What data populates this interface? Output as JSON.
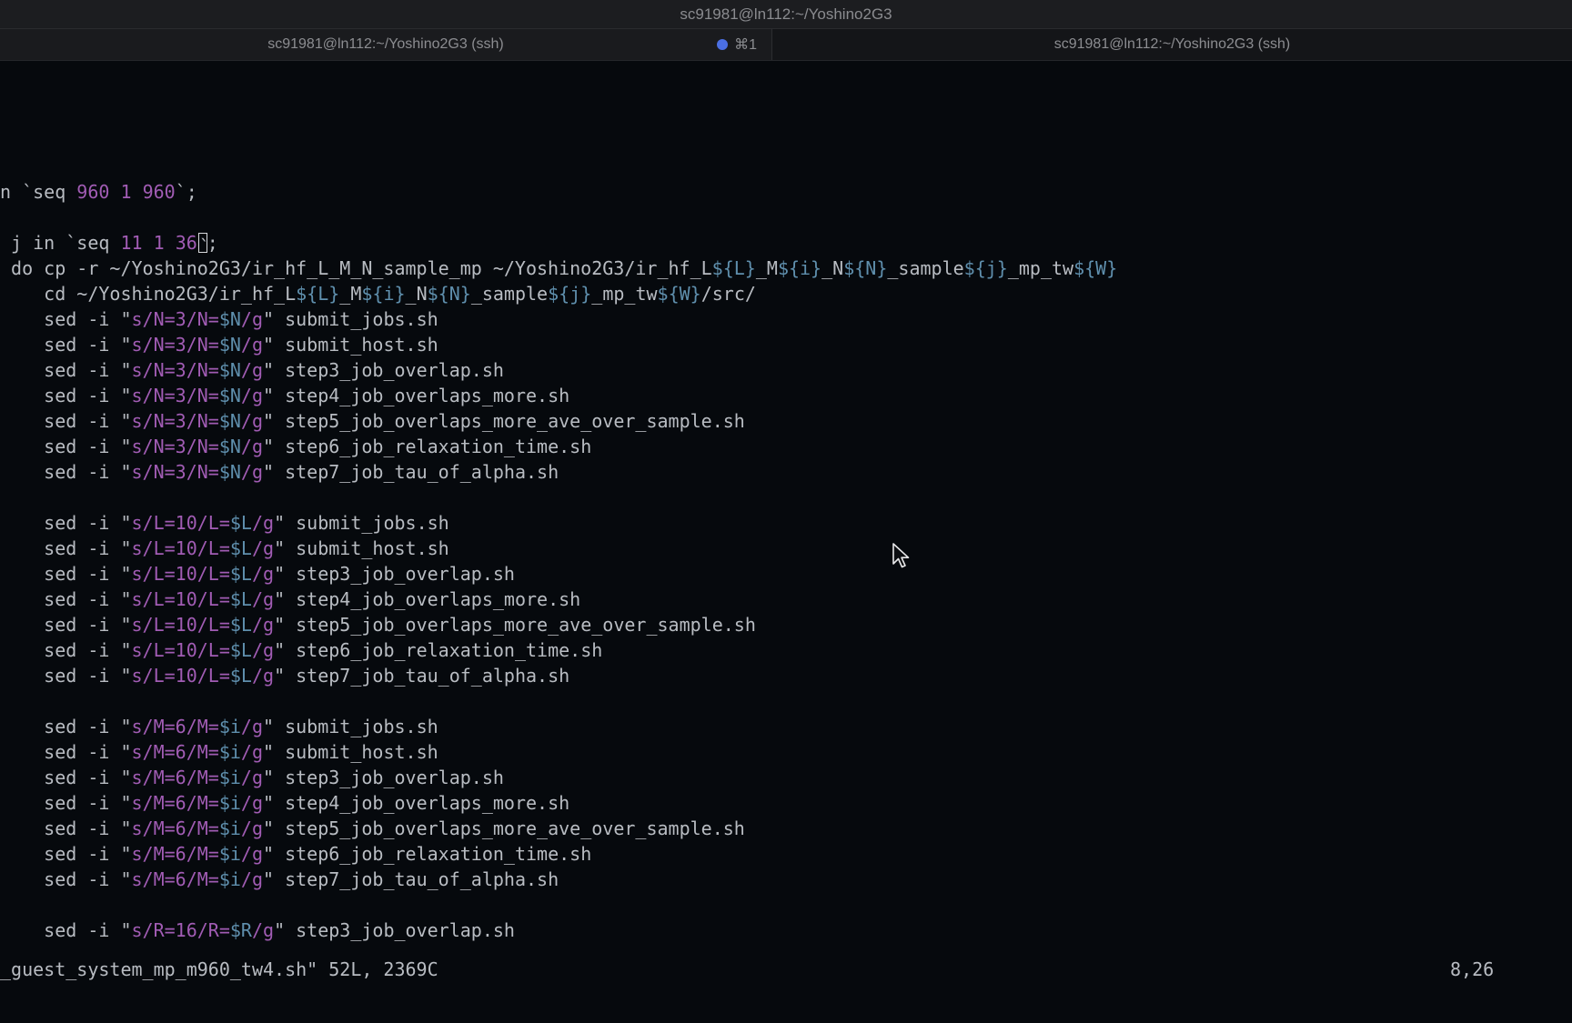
{
  "window": {
    "title": "sc91981@ln112:~/Yoshino2G3"
  },
  "tabs": [
    {
      "label": "sc91981@ln112:~/Yoshino2G3 (ssh)",
      "shortcut": "⌘1",
      "active": true,
      "activity_color": "#4b6fe3"
    },
    {
      "label": "sc91981@ln112:~/Yoshino2G3 (ssh)",
      "active": false
    }
  ],
  "terminal": {
    "lines": [
      {
        "row": 5,
        "segments": [
          {
            "t": "n `seq "
          },
          {
            "t": "960",
            "c": "p"
          },
          {
            "t": " "
          },
          {
            "t": "1",
            "c": "p"
          },
          {
            "t": " "
          },
          {
            "t": "960",
            "c": "p"
          },
          {
            "t": "`;"
          }
        ]
      },
      {
        "row": 7,
        "segments": [
          {
            "t": " j in `seq "
          },
          {
            "t": "11",
            "c": "p"
          },
          {
            "t": " "
          },
          {
            "t": "1",
            "c": "p"
          },
          {
            "t": " "
          },
          {
            "t": "36",
            "c": "p"
          },
          {
            "t": "`",
            "cursor": true
          },
          {
            "t": ";"
          }
        ]
      },
      {
        "row": 8,
        "segments": [
          {
            "t": " do cp -r ~/Yoshino2G3/ir_hf_L_M_N_sample_mp ~/Yoshino2G3/ir_hf_L"
          },
          {
            "t": "${L}",
            "c": "v"
          },
          {
            "t": "_M"
          },
          {
            "t": "${i}",
            "c": "v"
          },
          {
            "t": "_N"
          },
          {
            "t": "${N}",
            "c": "v"
          },
          {
            "t": "_sample"
          },
          {
            "t": "${j}",
            "c": "v"
          },
          {
            "t": "_mp_tw"
          },
          {
            "t": "${W}",
            "c": "v"
          }
        ]
      },
      {
        "row": 9,
        "segments": [
          {
            "t": "    cd ~/Yoshino2G3/ir_hf_L"
          },
          {
            "t": "${L}",
            "c": "v"
          },
          {
            "t": "_M"
          },
          {
            "t": "${i}",
            "c": "v"
          },
          {
            "t": "_N"
          },
          {
            "t": "${N}",
            "c": "v"
          },
          {
            "t": "_sample"
          },
          {
            "t": "${j}",
            "c": "v"
          },
          {
            "t": "_mp_tw"
          },
          {
            "t": "${W}",
            "c": "v"
          },
          {
            "t": "/src/"
          }
        ]
      },
      {
        "row": 10,
        "segments": [
          {
            "t": "    sed -i \""
          },
          {
            "t": "s/N=3/N=",
            "c": "p"
          },
          {
            "t": "$N",
            "c": "v"
          },
          {
            "t": "/g",
            "c": "p"
          },
          {
            "t": "\" submit_jobs.sh"
          }
        ]
      },
      {
        "row": 11,
        "segments": [
          {
            "t": "    sed -i \""
          },
          {
            "t": "s/N=3/N=",
            "c": "p"
          },
          {
            "t": "$N",
            "c": "v"
          },
          {
            "t": "/g",
            "c": "p"
          },
          {
            "t": "\" submit_host.sh"
          }
        ]
      },
      {
        "row": 12,
        "segments": [
          {
            "t": "    sed -i \""
          },
          {
            "t": "s/N=3/N=",
            "c": "p"
          },
          {
            "t": "$N",
            "c": "v"
          },
          {
            "t": "/g",
            "c": "p"
          },
          {
            "t": "\" step3_job_overlap.sh"
          }
        ]
      },
      {
        "row": 13,
        "segments": [
          {
            "t": "    sed -i \""
          },
          {
            "t": "s/N=3/N=",
            "c": "p"
          },
          {
            "t": "$N",
            "c": "v"
          },
          {
            "t": "/g",
            "c": "p"
          },
          {
            "t": "\" step4_job_overlaps_more.sh"
          }
        ]
      },
      {
        "row": 14,
        "segments": [
          {
            "t": "    sed -i \""
          },
          {
            "t": "s/N=3/N=",
            "c": "p"
          },
          {
            "t": "$N",
            "c": "v"
          },
          {
            "t": "/g",
            "c": "p"
          },
          {
            "t": "\" step5_job_overlaps_more_ave_over_sample.sh"
          }
        ]
      },
      {
        "row": 15,
        "segments": [
          {
            "t": "    sed -i \""
          },
          {
            "t": "s/N=3/N=",
            "c": "p"
          },
          {
            "t": "$N",
            "c": "v"
          },
          {
            "t": "/g",
            "c": "p"
          },
          {
            "t": "\" step6_job_relaxation_time.sh"
          }
        ]
      },
      {
        "row": 16,
        "segments": [
          {
            "t": "    sed -i \""
          },
          {
            "t": "s/N=3/N=",
            "c": "p"
          },
          {
            "t": "$N",
            "c": "v"
          },
          {
            "t": "/g",
            "c": "p"
          },
          {
            "t": "\" step7_job_tau_of_alpha.sh"
          }
        ]
      },
      {
        "row": 18,
        "segments": [
          {
            "t": "    sed -i \""
          },
          {
            "t": "s/L=10/L=",
            "c": "p"
          },
          {
            "t": "$L",
            "c": "v"
          },
          {
            "t": "/g",
            "c": "p"
          },
          {
            "t": "\" submit_jobs.sh"
          }
        ]
      },
      {
        "row": 19,
        "segments": [
          {
            "t": "    sed -i \""
          },
          {
            "t": "s/L=10/L=",
            "c": "p"
          },
          {
            "t": "$L",
            "c": "v"
          },
          {
            "t": "/g",
            "c": "p"
          },
          {
            "t": "\" submit_host.sh"
          }
        ]
      },
      {
        "row": 20,
        "segments": [
          {
            "t": "    sed -i \""
          },
          {
            "t": "s/L=10/L=",
            "c": "p"
          },
          {
            "t": "$L",
            "c": "v"
          },
          {
            "t": "/g",
            "c": "p"
          },
          {
            "t": "\" step3_job_overlap.sh"
          }
        ]
      },
      {
        "row": 21,
        "segments": [
          {
            "t": "    sed -i \""
          },
          {
            "t": "s/L=10/L=",
            "c": "p"
          },
          {
            "t": "$L",
            "c": "v"
          },
          {
            "t": "/g",
            "c": "p"
          },
          {
            "t": "\" step4_job_overlaps_more.sh"
          }
        ]
      },
      {
        "row": 22,
        "segments": [
          {
            "t": "    sed -i \""
          },
          {
            "t": "s/L=10/L=",
            "c": "p"
          },
          {
            "t": "$L",
            "c": "v"
          },
          {
            "t": "/g",
            "c": "p"
          },
          {
            "t": "\" step5_job_overlaps_more_ave_over_sample.sh"
          }
        ]
      },
      {
        "row": 23,
        "segments": [
          {
            "t": "    sed -i \""
          },
          {
            "t": "s/L=10/L=",
            "c": "p"
          },
          {
            "t": "$L",
            "c": "v"
          },
          {
            "t": "/g",
            "c": "p"
          },
          {
            "t": "\" step6_job_relaxation_time.sh"
          }
        ]
      },
      {
        "row": 24,
        "segments": [
          {
            "t": "    sed -i \""
          },
          {
            "t": "s/L=10/L=",
            "c": "p"
          },
          {
            "t": "$L",
            "c": "v"
          },
          {
            "t": "/g",
            "c": "p"
          },
          {
            "t": "\" step7_job_tau_of_alpha.sh"
          }
        ]
      },
      {
        "row": 26,
        "segments": [
          {
            "t": "    sed -i \""
          },
          {
            "t": "s/M=6/M=",
            "c": "p"
          },
          {
            "t": "$i",
            "c": "v"
          },
          {
            "t": "/g",
            "c": "p"
          },
          {
            "t": "\" submit_jobs.sh"
          }
        ]
      },
      {
        "row": 27,
        "segments": [
          {
            "t": "    sed -i \""
          },
          {
            "t": "s/M=6/M=",
            "c": "p"
          },
          {
            "t": "$i",
            "c": "v"
          },
          {
            "t": "/g",
            "c": "p"
          },
          {
            "t": "\" submit_host.sh"
          }
        ]
      },
      {
        "row": 28,
        "segments": [
          {
            "t": "    sed -i \""
          },
          {
            "t": "s/M=6/M=",
            "c": "p"
          },
          {
            "t": "$i",
            "c": "v"
          },
          {
            "t": "/g",
            "c": "p"
          },
          {
            "t": "\" step3_job_overlap.sh"
          }
        ]
      },
      {
        "row": 29,
        "segments": [
          {
            "t": "    sed -i \""
          },
          {
            "t": "s/M=6/M=",
            "c": "p"
          },
          {
            "t": "$i",
            "c": "v"
          },
          {
            "t": "/g",
            "c": "p"
          },
          {
            "t": "\" step4_job_overlaps_more.sh"
          }
        ]
      },
      {
        "row": 30,
        "segments": [
          {
            "t": "    sed -i \""
          },
          {
            "t": "s/M=6/M=",
            "c": "p"
          },
          {
            "t": "$i",
            "c": "v"
          },
          {
            "t": "/g",
            "c": "p"
          },
          {
            "t": "\" step5_job_overlaps_more_ave_over_sample.sh"
          }
        ]
      },
      {
        "row": 31,
        "segments": [
          {
            "t": "    sed -i \""
          },
          {
            "t": "s/M=6/M=",
            "c": "p"
          },
          {
            "t": "$i",
            "c": "v"
          },
          {
            "t": "/g",
            "c": "p"
          },
          {
            "t": "\" step6_job_relaxation_time.sh"
          }
        ]
      },
      {
        "row": 32,
        "segments": [
          {
            "t": "    sed -i \""
          },
          {
            "t": "s/M=6/M=",
            "c": "p"
          },
          {
            "t": "$i",
            "c": "v"
          },
          {
            "t": "/g",
            "c": "p"
          },
          {
            "t": "\" step7_job_tau_of_alpha.sh"
          }
        ]
      },
      {
        "row": 34,
        "segments": [
          {
            "t": "    sed -i \""
          },
          {
            "t": "s/R=16/R=",
            "c": "p"
          },
          {
            "t": "$R",
            "c": "v"
          },
          {
            "t": "/g",
            "c": "p"
          },
          {
            "t": "\" step3_job_overlap.sh"
          }
        ]
      }
    ]
  },
  "statusline": {
    "file_info": "_guest_system_mp_m960_tw4.sh\" 52L, 2369C",
    "cursor_position": "8,26"
  },
  "colors": {
    "background": "#06090d",
    "text": "#b8bcc2",
    "string_literal": "#a15cb4",
    "variable": "#5f8fad",
    "tab_activity": "#4b6fe3"
  }
}
